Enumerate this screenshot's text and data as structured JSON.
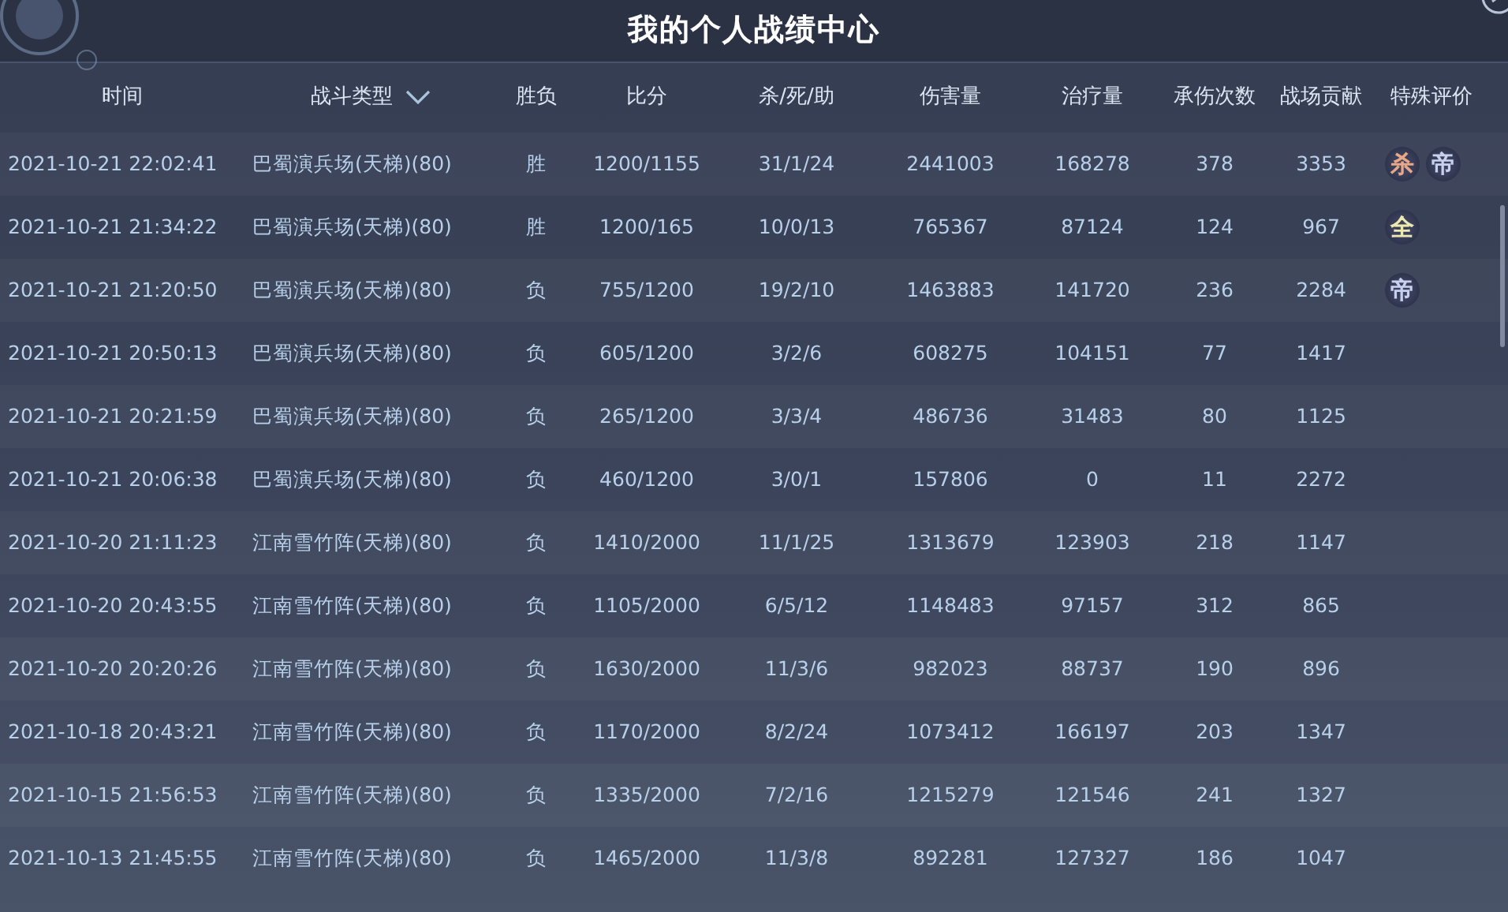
{
  "window": {
    "title": "我的个人战绩中心"
  },
  "table": {
    "columns": [
      {
        "label": "时间"
      },
      {
        "label": "战斗类型",
        "sortable": true
      },
      {
        "label": "胜负"
      },
      {
        "label": "比分"
      },
      {
        "label": "杀/死/助"
      },
      {
        "label": "伤害量"
      },
      {
        "label": "治疗量"
      },
      {
        "label": "承伤次数"
      },
      {
        "label": "战场贡献"
      },
      {
        "label": "特殊评价"
      }
    ],
    "rows": [
      {
        "cells": [
          "2021-10-21 22:02:41",
          "巴蜀演兵场(天梯)(80)",
          "胜",
          "1200/1155",
          "31/1/24",
          "2441003",
          "168278",
          "378",
          "3353"
        ],
        "badges": [
          {
            "text": "杀",
            "color": "#e8a888"
          },
          {
            "text": "帝",
            "color": "#c8d0f0"
          }
        ]
      },
      {
        "cells": [
          "2021-10-21 21:34:22",
          "巴蜀演兵场(天梯)(80)",
          "胜",
          "1200/165",
          "10/0/13",
          "765367",
          "87124",
          "124",
          "967"
        ],
        "badges": [
          {
            "text": "全",
            "color": "#ece8b0"
          }
        ]
      },
      {
        "cells": [
          "2021-10-21 21:20:50",
          "巴蜀演兵场(天梯)(80)",
          "负",
          "755/1200",
          "19/2/10",
          "1463883",
          "141720",
          "236",
          "2284"
        ],
        "badges": [
          {
            "text": "帝",
            "color": "#c8d0f0"
          }
        ]
      },
      {
        "cells": [
          "2021-10-21 20:50:13",
          "巴蜀演兵场(天梯)(80)",
          "负",
          "605/1200",
          "3/2/6",
          "608275",
          "104151",
          "77",
          "1417"
        ],
        "badges": []
      },
      {
        "cells": [
          "2021-10-21 20:21:59",
          "巴蜀演兵场(天梯)(80)",
          "负",
          "265/1200",
          "3/3/4",
          "486736",
          "31483",
          "80",
          "1125"
        ],
        "badges": []
      },
      {
        "cells": [
          "2021-10-21 20:06:38",
          "巴蜀演兵场(天梯)(80)",
          "负",
          "460/1200",
          "3/0/1",
          "157806",
          "0",
          "11",
          "2272"
        ],
        "badges": []
      },
      {
        "cells": [
          "2021-10-20 21:11:23",
          "江南雪竹阵(天梯)(80)",
          "负",
          "1410/2000",
          "11/1/25",
          "1313679",
          "123903",
          "218",
          "1147"
        ],
        "badges": []
      },
      {
        "cells": [
          "2021-10-20 20:43:55",
          "江南雪竹阵(天梯)(80)",
          "负",
          "1105/2000",
          "6/5/12",
          "1148483",
          "97157",
          "312",
          "865"
        ],
        "badges": []
      },
      {
        "cells": [
          "2021-10-20 20:20:26",
          "江南雪竹阵(天梯)(80)",
          "负",
          "1630/2000",
          "11/3/6",
          "982023",
          "88737",
          "190",
          "896"
        ],
        "badges": []
      },
      {
        "cells": [
          "2021-10-18 20:43:21",
          "江南雪竹阵(天梯)(80)",
          "负",
          "1170/2000",
          "8/2/24",
          "1073412",
          "166197",
          "203",
          "1347"
        ],
        "badges": []
      },
      {
        "cells": [
          "2021-10-15 21:56:53",
          "江南雪竹阵(天梯)(80)",
          "负",
          "1335/2000",
          "7/2/16",
          "1215279",
          "121546",
          "241",
          "1327"
        ],
        "badges": []
      },
      {
        "cells": [
          "2021-10-13 21:45:55",
          "江南雪竹阵(天梯)(80)",
          "负",
          "1465/2000",
          "11/3/8",
          "892281",
          "127327",
          "186",
          "1047"
        ],
        "badges": []
      }
    ]
  }
}
